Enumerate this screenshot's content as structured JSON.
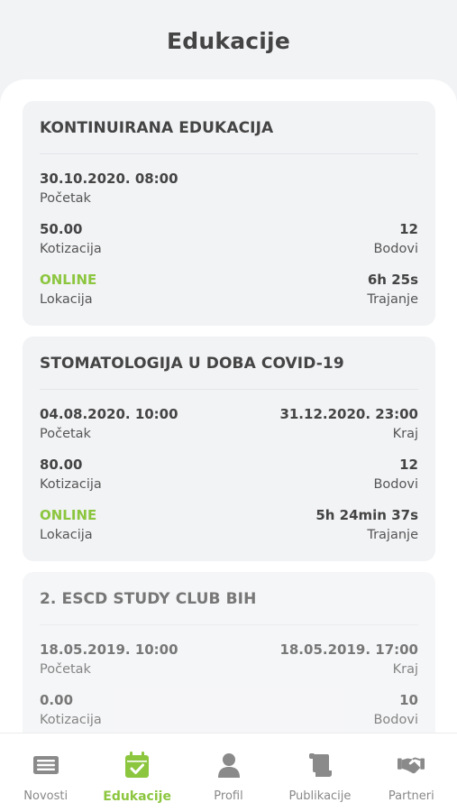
{
  "header": {
    "title": "Edukacije"
  },
  "events": [
    {
      "title": "KONTINUIRANA EDUKACIJA",
      "start_value": "30.10.2020. 08:00",
      "start_label": "Početak",
      "fee_value": "50.00",
      "fee_label": "Kotizacija",
      "points_value": "12",
      "points_label": "Bodovi",
      "location_value": "ONLINE",
      "location_label": "Lokacija",
      "duration_value": "6h 25s",
      "duration_label": "Trajanje"
    },
    {
      "title": "STOMATOLOGIJA U DOBA COVID-19",
      "start_value": "04.08.2020. 10:00",
      "start_label": "Početak",
      "end_value": "31.12.2020. 23:00",
      "end_label": "Kraj",
      "fee_value": "80.00",
      "fee_label": "Kotizacija",
      "points_value": "12",
      "points_label": "Bodovi",
      "location_value": "ONLINE",
      "location_label": "Lokacija",
      "duration_value": "5h 24min 37s",
      "duration_label": "Trajanje"
    },
    {
      "title": "2. ESCD STUDY CLUB BIH",
      "start_value": "18.05.2019. 10:00",
      "start_label": "Početak",
      "end_value": "18.05.2019. 17:00",
      "end_label": "Kraj",
      "fee_value": "0.00",
      "fee_label": "Kotizacija",
      "points_value": "10",
      "points_label": "Bodovi"
    }
  ],
  "tabbar": {
    "active_index": 1,
    "accent_color": "#8cc63f",
    "items": [
      {
        "label": "Novosti",
        "icon": "newspaper-icon"
      },
      {
        "label": "Edukacije",
        "icon": "calendar-check-icon"
      },
      {
        "label": "Profil",
        "icon": "user-icon"
      },
      {
        "label": "Publikacije",
        "icon": "scroll-icon"
      },
      {
        "label": "Partneri",
        "icon": "handshake-icon"
      }
    ]
  }
}
